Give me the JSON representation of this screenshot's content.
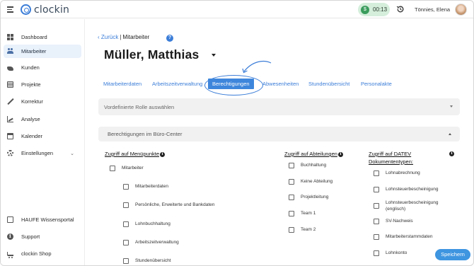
{
  "app": {
    "logo_text": "clockin"
  },
  "header": {
    "timer": "00:13",
    "user_name": "Tönnies, Elena"
  },
  "sidebar": {
    "items": [
      {
        "label": "Dashboard",
        "icon": "dashboard-icon"
      },
      {
        "label": "Mitarbeiter",
        "icon": "employees-icon",
        "active": true
      },
      {
        "label": "Kunden",
        "icon": "handshake-icon"
      },
      {
        "label": "Projekte",
        "icon": "projects-icon"
      },
      {
        "label": "Korrektur",
        "icon": "pencil-icon"
      },
      {
        "label": "Analyse",
        "icon": "chart-icon"
      },
      {
        "label": "Kalender",
        "icon": "calendar-icon"
      },
      {
        "label": "Einstellungen",
        "icon": "gear-icon"
      }
    ],
    "bottom_items": [
      {
        "label": "HAUFE Wissensportal",
        "icon": "book-icon"
      },
      {
        "label": "Support",
        "icon": "info-icon"
      },
      {
        "label": "clockin Shop",
        "icon": "cart-icon"
      }
    ]
  },
  "breadcrumb": {
    "back": "Zurück",
    "separator": "|",
    "current": "Mitarbeiter"
  },
  "page_title": "Müller, Matthias",
  "tabs": [
    {
      "label": "Mitarbeiterdaten"
    },
    {
      "label": "Arbeitszeitverwaltung"
    },
    {
      "label": "Berechtigungen",
      "active": true
    },
    {
      "label": "Abwesenheiten"
    },
    {
      "label": "Stundenübersicht"
    },
    {
      "label": "Personalakte"
    }
  ],
  "role_select": {
    "placeholder": "Vordefinierte Rolle auswählen"
  },
  "accordion": {
    "label": "Berechtigungen im Büro-Center"
  },
  "columns": {
    "menu": {
      "heading": "Zugriff auf Menüpunkte",
      "parent": "Mitarbeiter",
      "children": [
        "Mitarbeiterdaten",
        "Persönliche, Erweiterte und Bankdaten",
        "Lohnbuchhaltung",
        "Arbeitszeitverwaltung",
        "Stundenübersicht"
      ]
    },
    "departments": {
      "heading": "Zugriff auf Abteilungen",
      "items": [
        "Buchhaltung",
        "Keine Abteilung",
        "Projektleitung",
        "Team 1",
        "Team 2"
      ]
    },
    "datev": {
      "heading_line1": "Zugriff auf DATEV",
      "heading_line2": "Dokumententypen:",
      "items": [
        "Lohnabrechnung",
        "Lohnsteuerbescheinigung",
        "Lohnsteuerbescheinigung (englisch)",
        "SV-Nachweis",
        "Mitarbeiterstammdaten",
        "Lohnkonto"
      ]
    }
  },
  "actions": {
    "save": "Speichern"
  },
  "colors": {
    "accent": "#3e86dc",
    "timer_bg": "#d4eedb",
    "active_nav_bg": "#e9f1fb"
  }
}
